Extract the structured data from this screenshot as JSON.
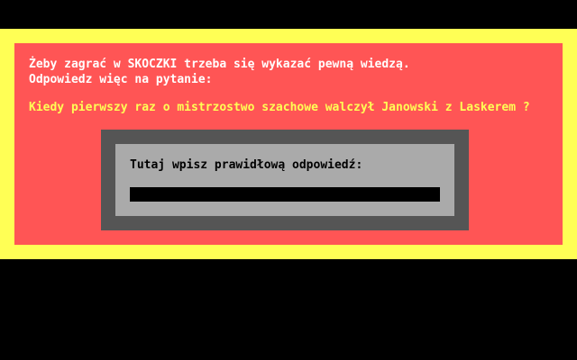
{
  "dialog": {
    "intro_line1": "Żeby zagrać w SKOCZKI trzeba się wykazać pewną wiedzą.",
    "intro_line2": "Odpowiedz więc na pytanie:",
    "question": "Kiedy pierwszy raz o mistrzostwo szachowe walczył Janowski z Laskerem ?",
    "answer_prompt": "Tutaj wpisz prawidłową odpowiedź:",
    "answer_value": ""
  },
  "colors": {
    "background": "#000000",
    "frame": "#ffff55",
    "panel": "#ff5555",
    "text_primary": "#ffffff",
    "text_question": "#ffff55",
    "box_outer": "#555555",
    "box_inner": "#aaaaaa",
    "input_field": "#000000"
  }
}
